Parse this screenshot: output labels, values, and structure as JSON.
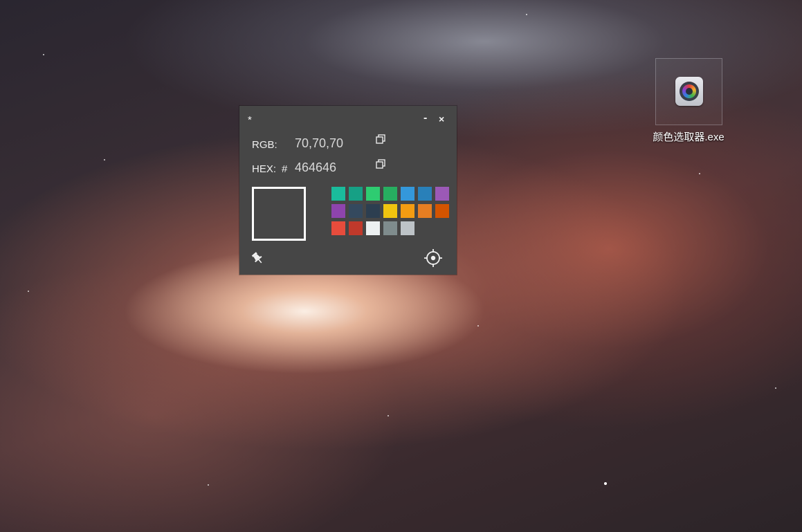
{
  "desktop": {
    "icon_label": "颜色选取器.exe",
    "icon_name": "color-picker-app-icon"
  },
  "window": {
    "title": "*",
    "minimize_label": "-",
    "close_label": "×",
    "rgb_label": "RGB:",
    "rgb_value": "70,70,70",
    "hex_label": "HEX:",
    "hex_hash": "#",
    "hex_value": "464646",
    "preview_color": "#464646",
    "swatches": [
      "#1abc9c",
      "#16a085",
      "#2ecc71",
      "#27ae60",
      "#3498db",
      "#2980b9",
      "#9b59b6",
      "#8e44ad",
      "#34495e",
      "#2c3e50",
      "#f1c40f",
      "#f39c12",
      "#e67e22",
      "#d35400",
      "#e74c3c",
      "#c0392b",
      "#ecf0f1",
      "#7f8c8d",
      "#bdc3c7"
    ],
    "icons": [
      "copy-icon",
      "copy-icon",
      "pin-icon",
      "crosshair-icon"
    ]
  }
}
